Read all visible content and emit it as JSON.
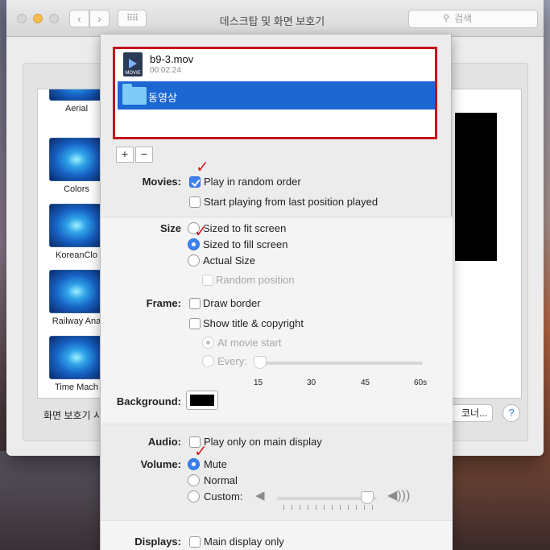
{
  "window": {
    "title": "데스크탑 및 화면 보호기",
    "search_placeholder": "검색",
    "nav_back": "‹",
    "nav_forward": "›",
    "grid_icon": "⠿⠿"
  },
  "savers": [
    {
      "label": "Aerial"
    },
    {
      "label": "Colors"
    },
    {
      "label": "KoreanClo"
    },
    {
      "label": "Railway Ana"
    },
    {
      "label": "Time Mach"
    }
  ],
  "bottom": {
    "start_label": "화면 보호기 시",
    "corner_button": "코너...",
    "help_button": "?"
  },
  "files": {
    "movie_name": "b9-3.mov",
    "movie_duration": "00:02:24",
    "movie_icon_text": "MOVIE",
    "folder_name": "동영상"
  },
  "list_buttons": {
    "add": "+",
    "remove": "−"
  },
  "movies": {
    "label": "Movies:",
    "random_order": "Play in random order",
    "random_order_checked": true,
    "last_position": "Start playing from last position played",
    "last_position_checked": false
  },
  "size": {
    "label": "Size",
    "fit": "Sized to fit screen",
    "fill": "Sized to fill screen",
    "actual": "Actual Size",
    "random_position": "Random position",
    "selected": "fill"
  },
  "frame": {
    "label": "Frame:",
    "draw_border": "Draw border",
    "show_title": "Show title & copyright",
    "at_start": "At movie start",
    "every": "Every:",
    "slider_ticks": [
      "15",
      "30",
      "45",
      "60s"
    ]
  },
  "background": {
    "label": "Background:",
    "color": "#000000"
  },
  "audio": {
    "label": "Audio:",
    "main_display": "Play only on main display"
  },
  "volume": {
    "label": "Volume:",
    "mute": "Mute",
    "normal": "Normal",
    "custom": "Custom:",
    "selected": "mute",
    "level": 0.9
  },
  "displays": {
    "label": "Displays:",
    "main_only": "Main display only"
  },
  "annotation": {
    "check_color": "#d01a1a",
    "check_glyph": "✓"
  },
  "colors": {
    "accent": "#3b82f0",
    "selection": "#1c67d2",
    "highlight_border": "#c4101b"
  }
}
